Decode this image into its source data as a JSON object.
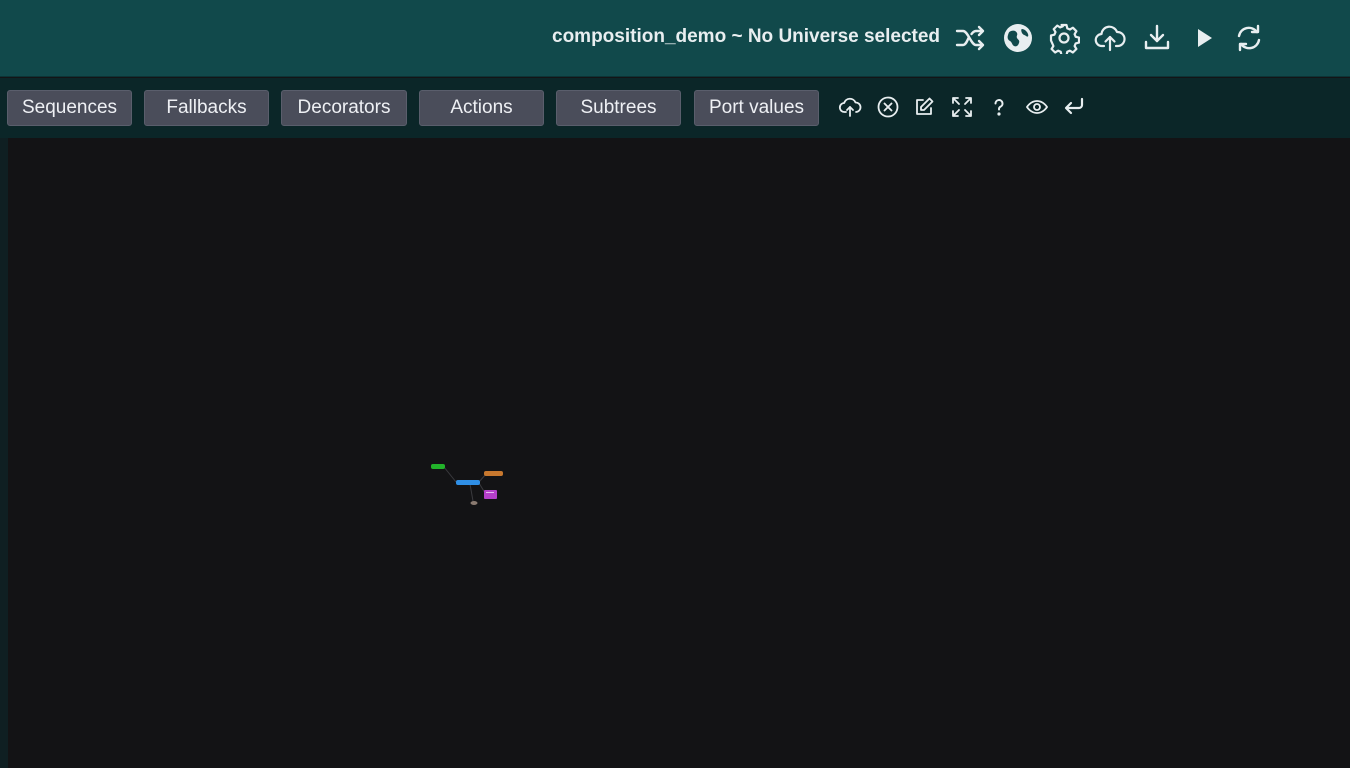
{
  "header": {
    "title": "composition_demo ~ No Universe selected",
    "icons": [
      {
        "name": "shuffle-icon"
      },
      {
        "name": "universe-globe-icon"
      },
      {
        "name": "settings-gear-icon"
      },
      {
        "name": "cloud-upload-icon"
      },
      {
        "name": "download-icon"
      },
      {
        "name": "play-icon"
      },
      {
        "name": "refresh-icon"
      }
    ]
  },
  "palette": {
    "buttons": [
      "Sequences",
      "Fallbacks",
      "Decorators",
      "Actions",
      "Subtrees",
      "Port values"
    ],
    "tools": [
      {
        "name": "cloud-upload-small-icon"
      },
      {
        "name": "close-circle-icon"
      },
      {
        "name": "edit-icon"
      },
      {
        "name": "fullscreen-icon"
      },
      {
        "name": "help-icon"
      },
      {
        "name": "eye-icon"
      },
      {
        "name": "undo-return-icon"
      }
    ]
  },
  "canvas": {
    "nodes": [
      {
        "kind": "root",
        "color": "#22b32a"
      },
      {
        "kind": "sequence",
        "color": "#2f8fe6"
      },
      {
        "kind": "action",
        "color": "#c8782e"
      },
      {
        "kind": "subtree",
        "color": "#b53fc9"
      },
      {
        "kind": "port",
        "color": "#8a7a70"
      }
    ]
  },
  "colors": {
    "header_bg": "#11494b",
    "toolbar_bg": "#0b2628",
    "canvas_bg": "#131315",
    "button_bg": "#4a4d5a"
  }
}
